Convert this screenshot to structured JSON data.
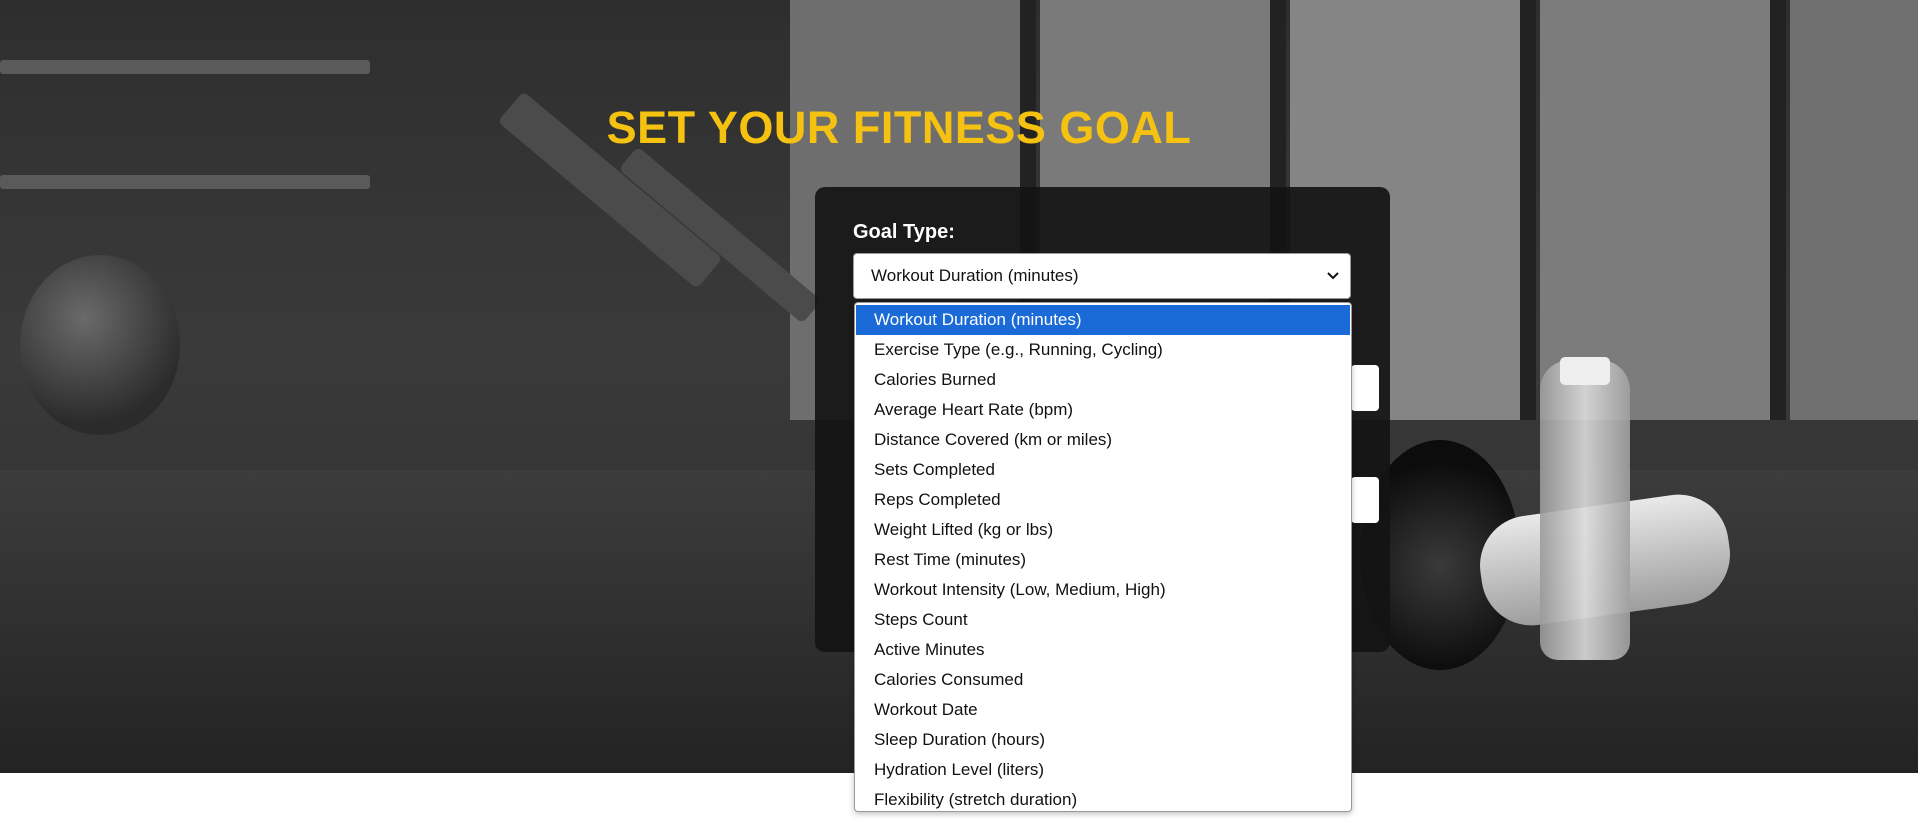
{
  "page": {
    "title": "SET YOUR FITNESS GOAL"
  },
  "form": {
    "goal_type_label": "Goal Type:",
    "goal_type_selected": "Workout Duration (minutes)"
  },
  "dropdown": {
    "options": [
      "Workout Duration (minutes)",
      "Exercise Type (e.g., Running, Cycling)",
      "Calories Burned",
      "Average Heart Rate (bpm)",
      "Distance Covered (km or miles)",
      "Sets Completed",
      "Reps Completed",
      "Weight Lifted (kg or lbs)",
      "Rest Time (minutes)",
      "Workout Intensity (Low, Medium, High)",
      "Steps Count",
      "Active Minutes",
      "Calories Consumed",
      "Workout Date",
      "Sleep Duration (hours)",
      "Hydration Level (liters)",
      "Flexibility (stretch duration)"
    ],
    "selected_index": 0
  },
  "colors": {
    "title": "#f6c211",
    "highlight": "#1a6ad8",
    "card": "#141414"
  }
}
